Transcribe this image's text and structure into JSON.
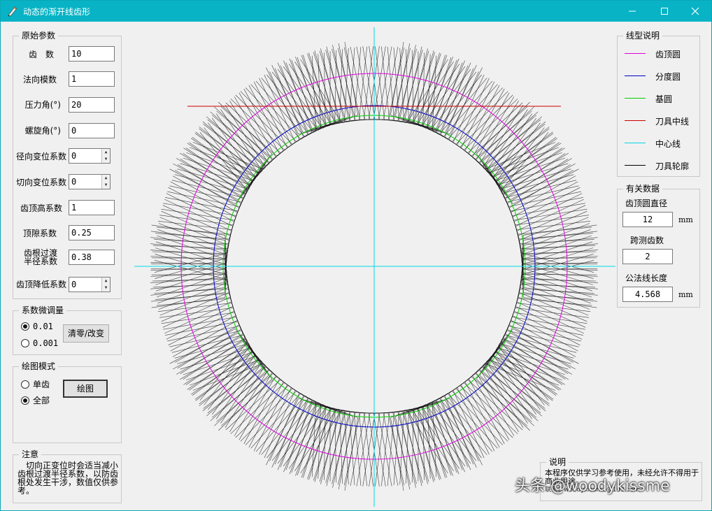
{
  "window": {
    "title": "动态的渐开线齿形",
    "controls": [
      "minimize",
      "maximize",
      "close"
    ]
  },
  "params": {
    "legend": "原始参数",
    "fields": [
      {
        "label": "齿　数",
        "value": "10"
      },
      {
        "label": "法向模数",
        "value": "1"
      },
      {
        "label": "压力角(°)",
        "value": "20"
      },
      {
        "label": "螺旋角(°)",
        "value": "0"
      },
      {
        "label": "径向变位系数",
        "value": "0",
        "spin": true
      },
      {
        "label": "切向变位系数",
        "value": "0",
        "spin": true
      },
      {
        "label": "齿顶高系数",
        "value": "1"
      },
      {
        "label": "顶隙系数",
        "value": "0.25"
      },
      {
        "label": "齿根过渡\n半径系数",
        "value": "0.38"
      },
      {
        "label": "齿顶降低系数",
        "value": "0",
        "spin": true
      }
    ]
  },
  "tune": {
    "legend": "系数微调量",
    "options": [
      "0.01",
      "0.001"
    ],
    "selected": "0.01",
    "reset_label": "清零/改变"
  },
  "draw_mode": {
    "legend": "绘图模式",
    "options": [
      "单齿",
      "全部"
    ],
    "selected": "全部",
    "draw_label": "绘图"
  },
  "note": {
    "legend": "注意",
    "text": "　切向正变位时会适当减小齿根过渡半径系数，以防齿根处发生干涉，数值仅供参考。"
  },
  "line_legend": {
    "legend": "线型说明",
    "items": [
      {
        "name": "齿顶圆",
        "color": "#e000e0"
      },
      {
        "name": "分度圆",
        "color": "#0000c8"
      },
      {
        "name": "基圆",
        "color": "#00d000"
      },
      {
        "name": "刀具中线",
        "color": "#d00000"
      },
      {
        "name": "中心线",
        "color": "#00d8e8"
      },
      {
        "name": "刀具轮廓",
        "color": "#000000"
      }
    ]
  },
  "results": {
    "legend": "有关数据",
    "tip_diameter_label": "齿顶圆直径",
    "tip_diameter_value": "12",
    "tip_diameter_unit": "mm",
    "span_teeth_label": "跨测齿数",
    "span_teeth_value": "2",
    "base_tangent_label": "公法线长度",
    "base_tangent_value": "4.568",
    "base_tangent_unit": "mm"
  },
  "info": {
    "legend": "说明",
    "text": "本程序仅供学习参考使用，未经允许不得用于商业用途。",
    "text2": "联系：woodykissme@163.com"
  },
  "watermark": "头条 @woodykissme"
}
